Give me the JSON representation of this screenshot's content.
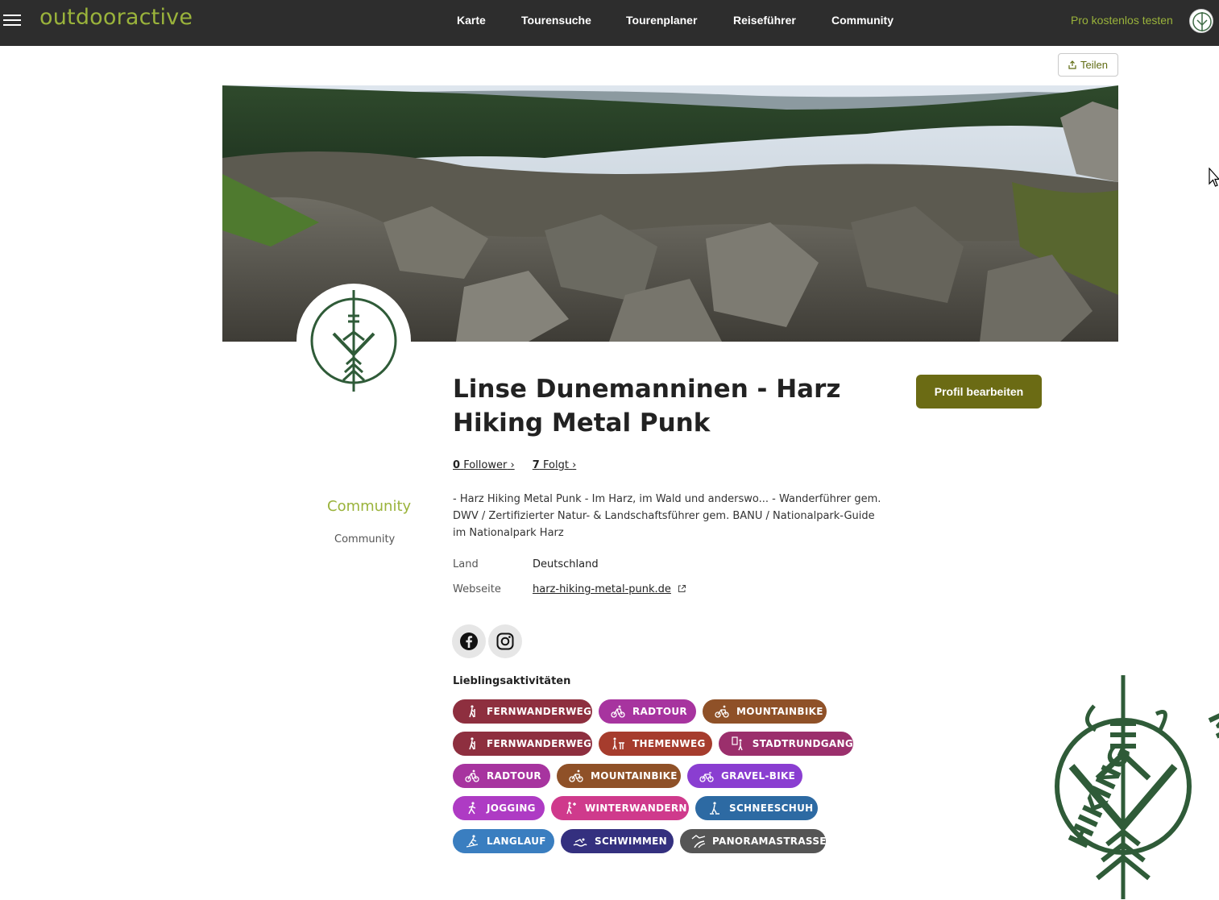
{
  "topbar": {
    "brand": "outdooractive",
    "nav": [
      "Karte",
      "Tourensuche",
      "Tourenplaner",
      "Reiseführer",
      "Community"
    ],
    "pro_link": "Pro kostenlos testen"
  },
  "share": {
    "label": "Teilen"
  },
  "profile": {
    "name": "Linse Dunemanninen - Harz Hiking Metal Punk",
    "edit_button": "Profil bearbeiten",
    "followers_count": "0",
    "followers_label": "Follower",
    "following_count": "7",
    "following_label": "Folgt",
    "bio": "- Harz Hiking Metal Punk - Im Harz, im Wald und anderswo... - Wanderführer gem. DWV / Zertifizierter Natur- & Landschaftsführer gem. BANU / Nationalpark-Guide im Nationalpark Harz",
    "country_label": "Land",
    "country_value": "Deutschland",
    "website_label": "Webseite",
    "website_value": "harz-hiking-metal-punk.de"
  },
  "sidebar": {
    "title": "Community",
    "subtitle": "Community"
  },
  "social": {
    "facebook": "facebook-icon",
    "instagram": "instagram-icon"
  },
  "activities": {
    "title": "Lieblingsaktivitäten",
    "items": [
      {
        "label": "FERNWANDERWEG",
        "color": "#8e2f3f",
        "icon": "hiker-icon"
      },
      {
        "label": "RADTOUR",
        "color": "#a7349f",
        "icon": "bicycle-icon"
      },
      {
        "label": "MOUNTAINBIKE",
        "color": "#8f5128",
        "icon": "mountainbike-icon"
      },
      {
        "label": "FERNWANDERWEG",
        "color": "#8e2f3f",
        "icon": "hiker-icon"
      },
      {
        "label": "THEMENWEG",
        "color": "#a63c2d",
        "icon": "signpost-hiker-icon"
      },
      {
        "label": "STADTRUNDGANG",
        "color": "#9b2f6c",
        "icon": "city-walk-icon"
      },
      {
        "label": "RADTOUR",
        "color": "#a7349f",
        "icon": "bicycle-icon"
      },
      {
        "label": "MOUNTAINBIKE",
        "color": "#8f5128",
        "icon": "mountainbike-icon"
      },
      {
        "label": "GRAVEL-BIKE",
        "color": "#8a3ed1",
        "icon": "gravel-bike-icon"
      },
      {
        "label": "JOGGING",
        "color": "#ae3bc4",
        "icon": "runner-icon"
      },
      {
        "label": "WINTERWANDERN",
        "color": "#cf3a8c",
        "icon": "winter-hiker-icon"
      },
      {
        "label": "SCHNEESCHUH",
        "color": "#2d6aa3",
        "icon": "snowshoe-icon"
      },
      {
        "label": "LANGLAUF",
        "color": "#3a7ec0",
        "icon": "cross-country-ski-icon"
      },
      {
        "label": "SCHWIMMEN",
        "color": "#34307f",
        "icon": "swimmer-icon"
      },
      {
        "label": "PANORAMASTRASSE",
        "color": "#555555",
        "icon": "panorama-road-icon"
      }
    ]
  },
  "colors": {
    "brand": "#9ab33b",
    "topbar": "#2d2d2d",
    "edit_button": "#6b6b14"
  }
}
